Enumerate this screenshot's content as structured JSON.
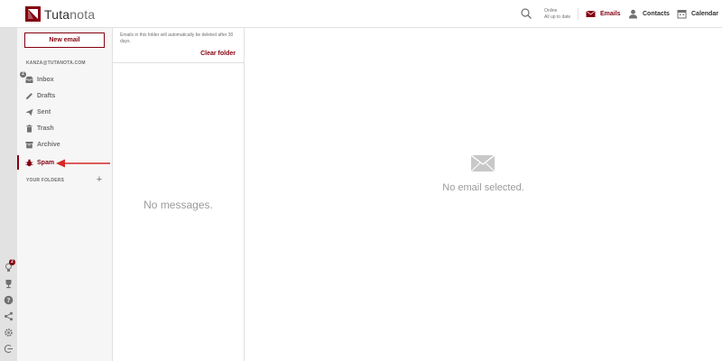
{
  "app": {
    "logo_prefix": "Tuta",
    "logo_suffix": "nota"
  },
  "header": {
    "status_line1": "Online",
    "status_line2": "All up to date",
    "nav": {
      "emails": "Emails",
      "contacts": "Contacts",
      "calendar": "Calendar"
    }
  },
  "rail": {
    "news_badge": "2",
    "icons": [
      "lightbulb-icon",
      "trophy-icon",
      "help-icon",
      "share-icon",
      "settings-icon",
      "logout-icon"
    ]
  },
  "folders": {
    "new_email_label": "New email",
    "account": "KANZA@TUTANOTA.COM",
    "account_badge": "2",
    "items": [
      {
        "label": "Inbox",
        "icon": "inbox-icon"
      },
      {
        "label": "Drafts",
        "icon": "pencil-icon"
      },
      {
        "label": "Sent",
        "icon": "send-icon"
      },
      {
        "label": "Trash",
        "icon": "trash-icon"
      },
      {
        "label": "Archive",
        "icon": "archive-icon"
      },
      {
        "label": "Spam",
        "icon": "bug-icon"
      }
    ],
    "selected": "Spam",
    "your_folders_label": "YOUR FOLDERS",
    "add_folder_label": "+"
  },
  "mail_list": {
    "notice": "Emails in this folder will automatically be deleted after 30 days.",
    "clear_folder_label": "Clear folder",
    "empty_text": "No messages."
  },
  "viewer": {
    "empty_text": "No email selected."
  },
  "colors": {
    "accent": "#840010",
    "annotation_arrow": "#d62828",
    "muted_text": "#707070",
    "placeholder_text": "#9b9b9b",
    "sidebar_bg": "#f6f6f6",
    "rail_bg": "#e2e2e2"
  }
}
